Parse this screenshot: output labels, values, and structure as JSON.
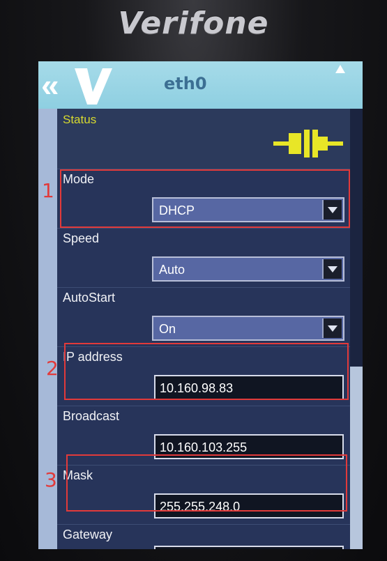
{
  "device": {
    "brand": "Verifone"
  },
  "titlebar": {
    "title": "eth0",
    "back_glyph": "«",
    "up_glyph": "▲"
  },
  "status": {
    "label": "Status",
    "icon": "ethernet-plug-icon",
    "icon_color": "#e8e627"
  },
  "rows": [
    {
      "label": "Mode",
      "type": "dropdown",
      "value": "DHCP"
    },
    {
      "label": "Speed",
      "type": "dropdown",
      "value": "Auto"
    },
    {
      "label": "AutoStart",
      "type": "dropdown",
      "value": "On"
    },
    {
      "label": "IP address",
      "type": "text",
      "value": "10.160.98.83"
    },
    {
      "label": "Broadcast",
      "type": "text",
      "value": "10.160.103.255"
    },
    {
      "label": "Mask",
      "type": "text",
      "value": "255.255.248.0"
    },
    {
      "label": "Gateway",
      "type": "text",
      "value": ""
    }
  ],
  "annotations": [
    {
      "number": "1",
      "target": "Mode"
    },
    {
      "number": "2",
      "target": "IP address"
    },
    {
      "number": "3",
      "target": "Mask"
    }
  ],
  "colors": {
    "titlebar": "#a6dbe9",
    "annotation": "#e23a3a",
    "list_background": "#27345a"
  }
}
